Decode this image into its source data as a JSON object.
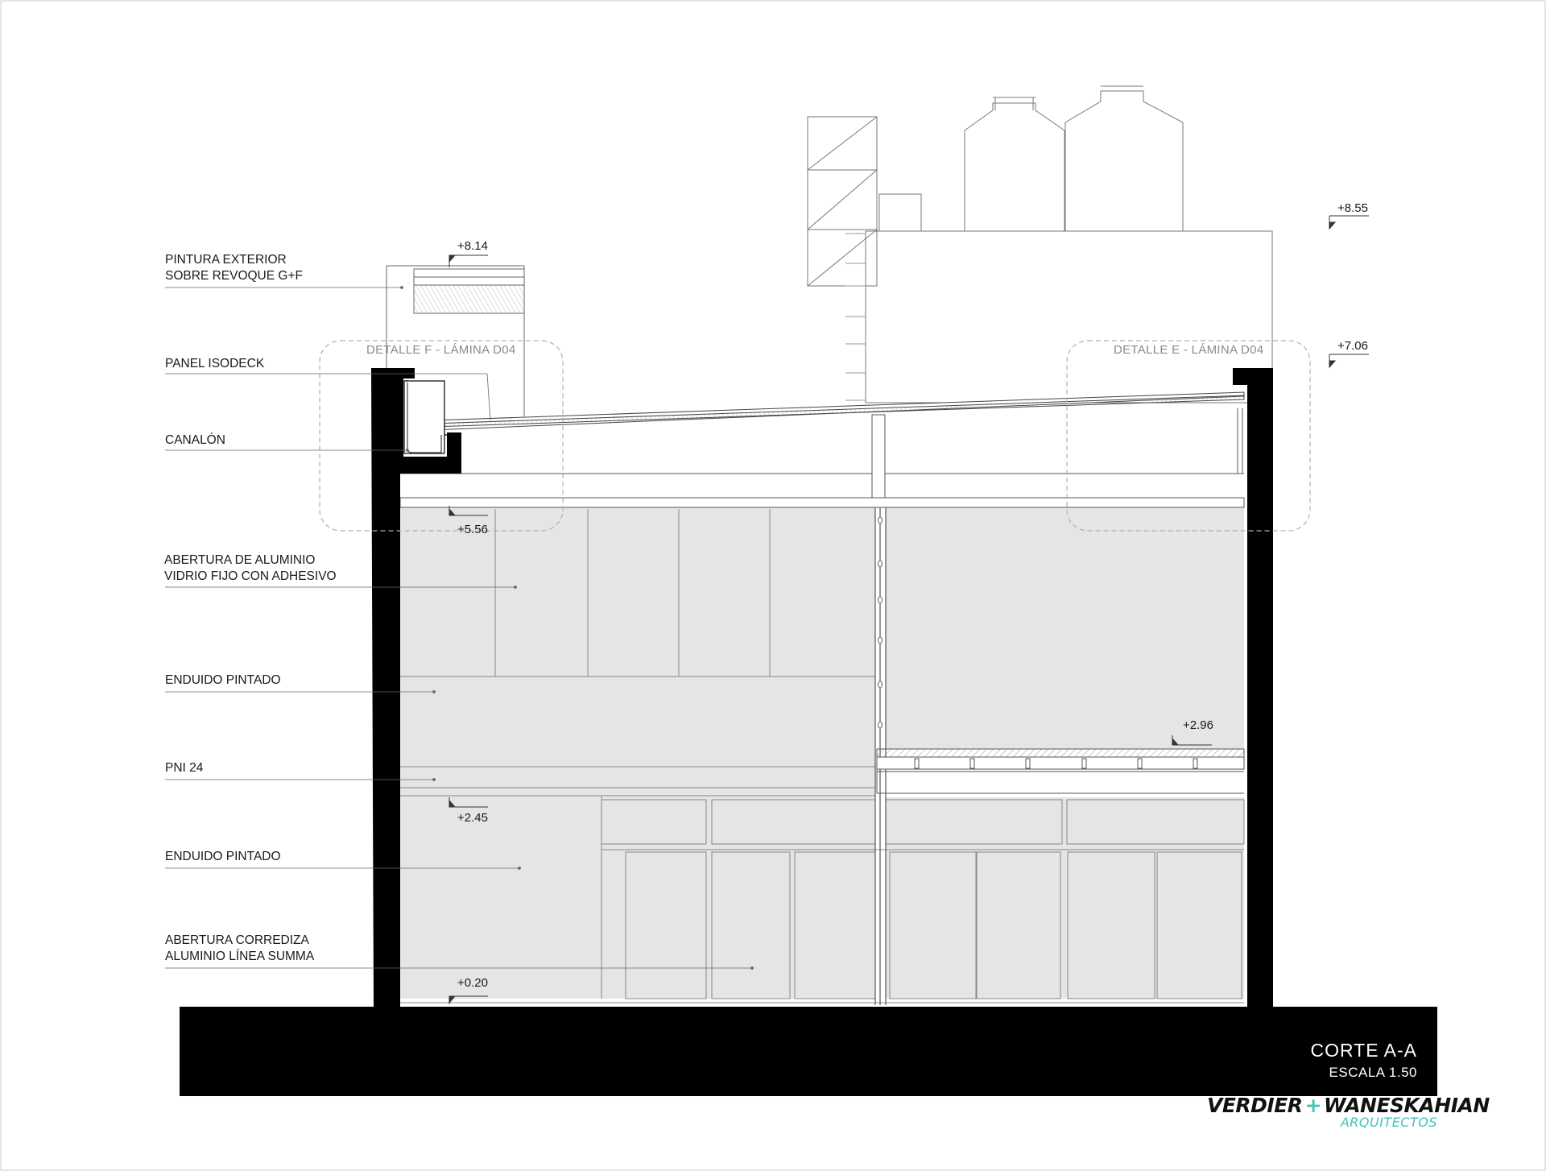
{
  "annotations": [
    {
      "line1": "PINTURA EXTERIOR",
      "line2": "SOBRE REVOQUE G+F"
    },
    {
      "line1": "PANEL ISODECK"
    },
    {
      "line1": "CANALÓN"
    },
    {
      "line1": "ABERTURA DE ALUMINIO",
      "line2": "VIDRIO FIJO CON ADHESIVO"
    },
    {
      "line1": "ENDUIDO PINTADO"
    },
    {
      "line1": "PNI 24"
    },
    {
      "line1": "ENDUIDO PINTADO"
    },
    {
      "line1": "ABERTURA CORREDIZA",
      "line2": "ALUMINIO LÍNEA SUMMA"
    }
  ],
  "levels": [
    "+8.55",
    "+8.14",
    "+7.06",
    "+5.56",
    "+2.96",
    "+2.45",
    "+0.20"
  ],
  "details": [
    "DETALLE F - LÁMINA D04",
    "DETALLE E - LÁMINA D04"
  ],
  "title": {
    "name": "CORTE A-A",
    "scale": "ESCALA 1.50"
  },
  "logo": {
    "left": "VERDIER",
    "plus": "+",
    "right": "WANESKAHIAN",
    "sub": "ARQUITECTOS"
  },
  "colors": {
    "wall": "#000000",
    "glass": "#e5e5e5",
    "accent": "#41c3bd",
    "line": "#555555"
  }
}
